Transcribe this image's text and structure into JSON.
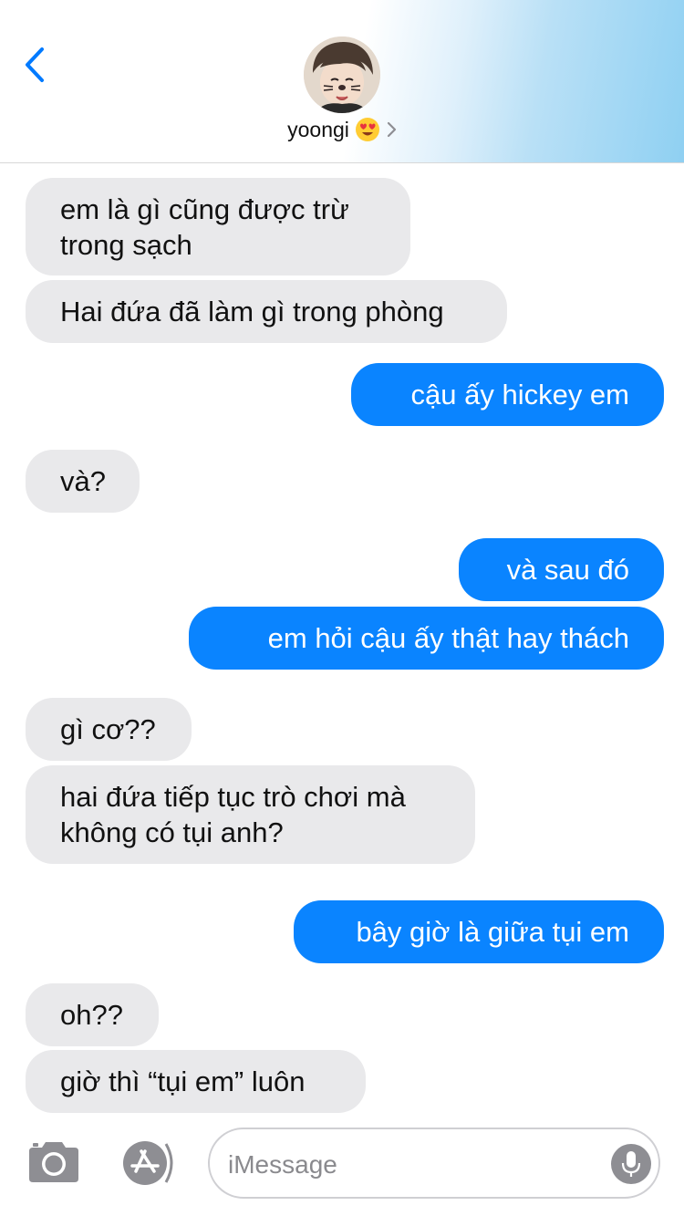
{
  "header": {
    "contact_name": "yoongi",
    "back_icon": "chevron-left-icon",
    "emoji_icon": "heart-eyes-emoji-icon",
    "detail_icon": "chevron-right-icon"
  },
  "messages": [
    {
      "direction": "received",
      "lines": [
        "em là gì cũng được trừ",
        "trong sạch"
      ]
    },
    {
      "direction": "received",
      "lines": [
        "Hai đứa đã làm gì trong phòng"
      ]
    },
    {
      "direction": "sent",
      "lines": [
        "cậu ấy hickey em"
      ]
    },
    {
      "direction": "received",
      "lines": [
        "và?"
      ]
    },
    {
      "direction": "sent",
      "lines": [
        "và sau đó"
      ]
    },
    {
      "direction": "sent",
      "lines": [
        "em hỏi cậu ấy thật hay thách"
      ]
    },
    {
      "direction": "received",
      "lines": [
        "gì cơ??"
      ]
    },
    {
      "direction": "received",
      "lines": [
        "hai đứa tiếp tục trò chơi mà",
        "không có tụi anh?"
      ]
    },
    {
      "direction": "sent",
      "lines": [
        "bây giờ là giữa tụi em"
      ]
    },
    {
      "direction": "received",
      "lines": [
        "oh??"
      ]
    },
    {
      "direction": "received",
      "lines": [
        "giờ thì “tụi em” luôn"
      ]
    }
  ],
  "input_bar": {
    "placeholder": "iMessage",
    "value": "",
    "camera_icon": "camera-icon",
    "apps_icon": "app-store-icon",
    "mic_icon": "microphone-icon"
  },
  "colors": {
    "sent_bubble": "#0a84ff",
    "received_bubble": "#e9e9eb",
    "accent": "#007aff"
  }
}
